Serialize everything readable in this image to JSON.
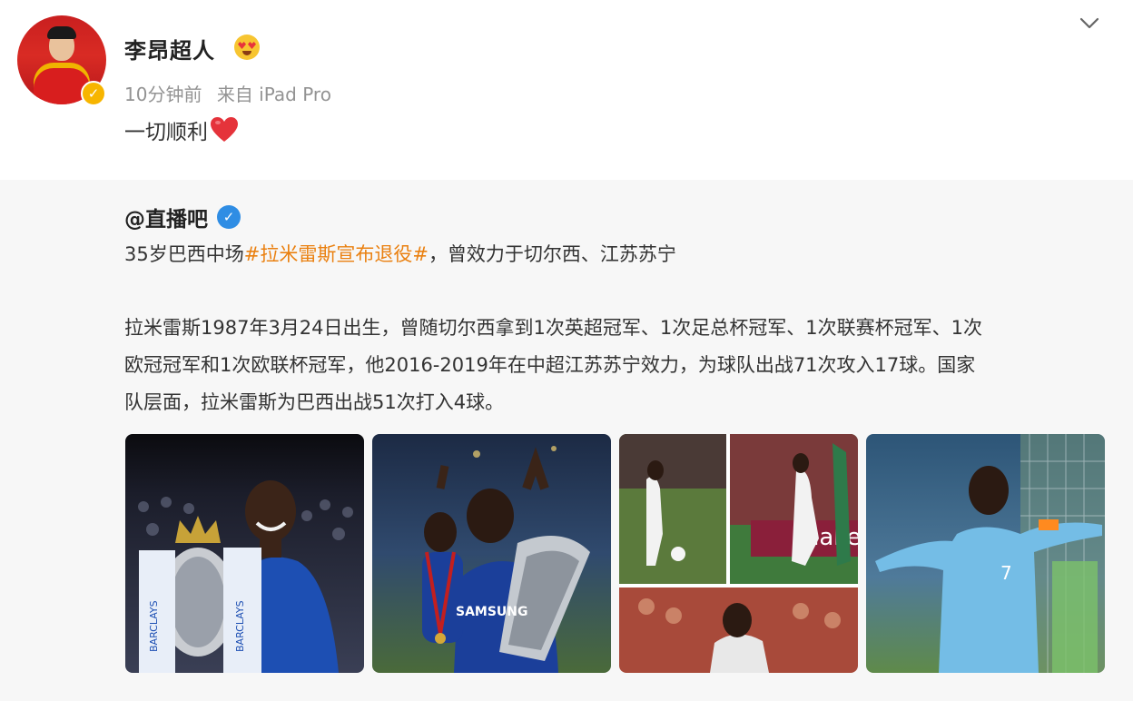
{
  "post": {
    "username": "李昂超人",
    "time": "10分钟前",
    "source": "来自 iPad Pro",
    "text": "一切顺利"
  },
  "repost": {
    "author": "@直播吧",
    "line1_prefix": "35岁巴西中场",
    "hashtag": "#拉米雷斯宣布退役#",
    "line1_suffix": "，曾效力于切尔西、江苏苏宁",
    "line2": "拉米雷斯1987年3月24日出生，曾随切尔西拿到1次英超冠军、1次足总杯冠军、1次联赛杯冠军、1次",
    "line3": "欧冠冠军和1次欧联杯冠军，他2016-2019年在中超江苏苏宁效力，为球队出战71次攻入17球。国家",
    "line4": "队层面，拉米雷斯为巴西出战51次打入4球。",
    "photos": [
      {
        "caption_text": "BARCLAYS"
      },
      {
        "caption_text": "SAMSUNG"
      },
      {
        "caption_text": "make"
      },
      {
        "caption_text": "7"
      }
    ]
  },
  "icons": {
    "more": "chevron-down-icon",
    "verified_gold": "verified-gold-icon",
    "verified_blue": "verified-blue-icon",
    "emoji": "heart-eyes-emoji-icon",
    "heart": "red-heart-emoji-icon"
  },
  "colors": {
    "hashtag": "#ea8010",
    "meta": "#939393",
    "repost_bg": "#f7f7f7",
    "verified_blue": "#2f8de4",
    "verified_gold": "#f7b500"
  }
}
